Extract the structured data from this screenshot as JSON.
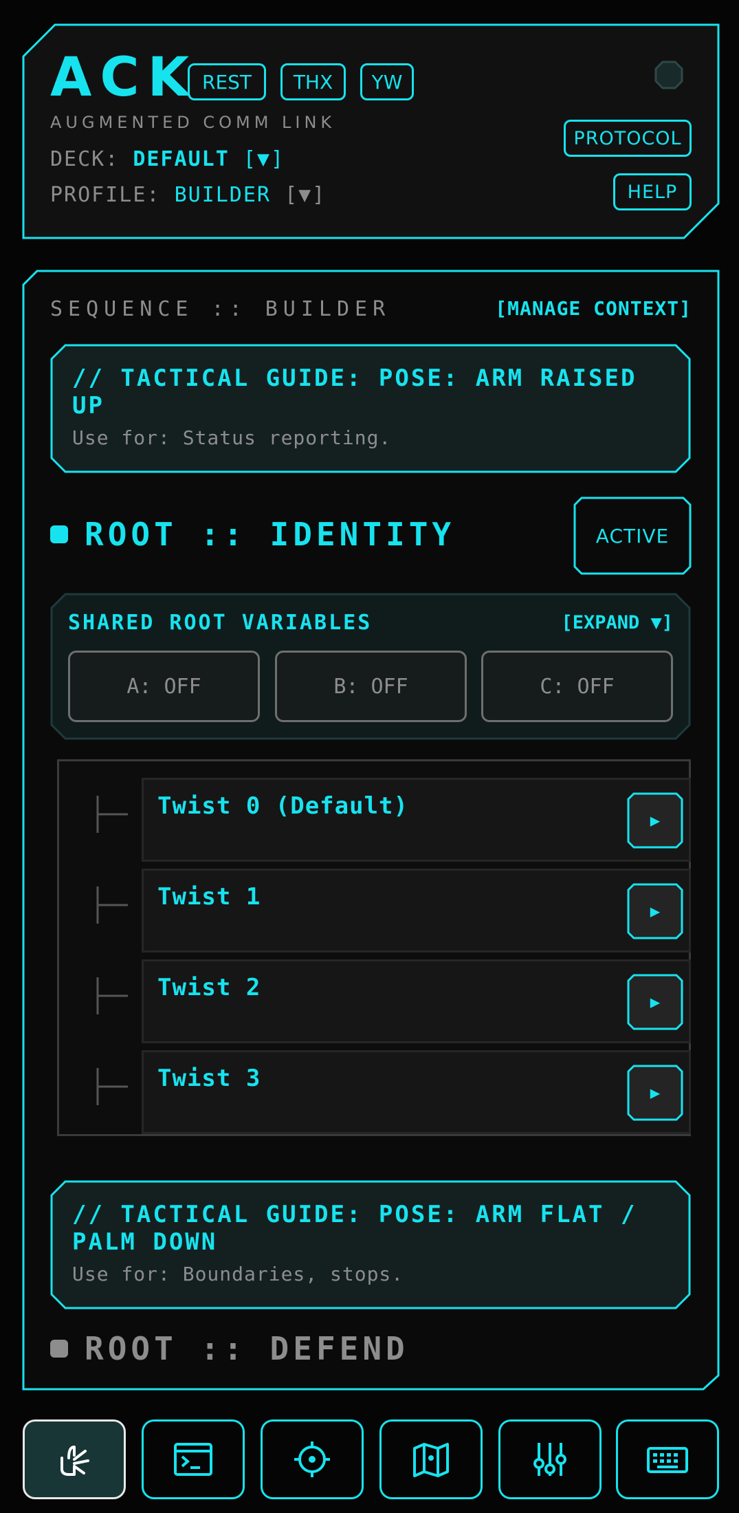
{
  "app": {
    "title": "ACK",
    "subtitle": "AUGMENTED COMM LINK",
    "quick_replies": [
      "REST",
      "THX",
      "YW"
    ],
    "deck_label": "DECK:",
    "deck_value": "DEFAULT",
    "deck_arrow": "[▼]",
    "profile_label": "PROFILE:",
    "profile_value": "BUILDER",
    "profile_arrow": "[▼]",
    "protocol_button": "PROTOCOL",
    "help_button": "HELP"
  },
  "sequence": {
    "label": "SEQUENCE :: BUILDER",
    "manage_context": "[MANAGE CONTEXT]"
  },
  "guide_1": {
    "title": "// TACTICAL GUIDE: POSE: ARM RAISED UP",
    "use_for": "Use for: Status reporting."
  },
  "root_identity": {
    "title": "ROOT :: IDENTITY",
    "status_button": "ACTIVE"
  },
  "shared_vars": {
    "title": "SHARED ROOT VARIABLES",
    "expand": "[EXPAND ▼]",
    "vars": [
      "A: OFF",
      "B: OFF",
      "C: OFF"
    ]
  },
  "twists": [
    {
      "name": "Twist 0 (Default)",
      "play": "▶"
    },
    {
      "name": "Twist 1",
      "play": "▶"
    },
    {
      "name": "Twist 2",
      "play": "▶"
    },
    {
      "name": "Twist 3",
      "play": "▶"
    }
  ],
  "guide_2": {
    "title": "// TACTICAL GUIDE: POSE: ARM FLAT / PALM DOWN",
    "use_for": "Use for: Boundaries, stops."
  },
  "root_defend": {
    "title": "ROOT :: DEFEND"
  },
  "colors": {
    "accent": "#17e3ef",
    "muted": "#8d8d8d",
    "background": "#050505",
    "panel": "#101818"
  },
  "nav_icons": [
    "gesture-hand-icon",
    "terminal-icon",
    "crosshair-icon",
    "map-icon",
    "sliders-icon",
    "keyboard-icon"
  ]
}
